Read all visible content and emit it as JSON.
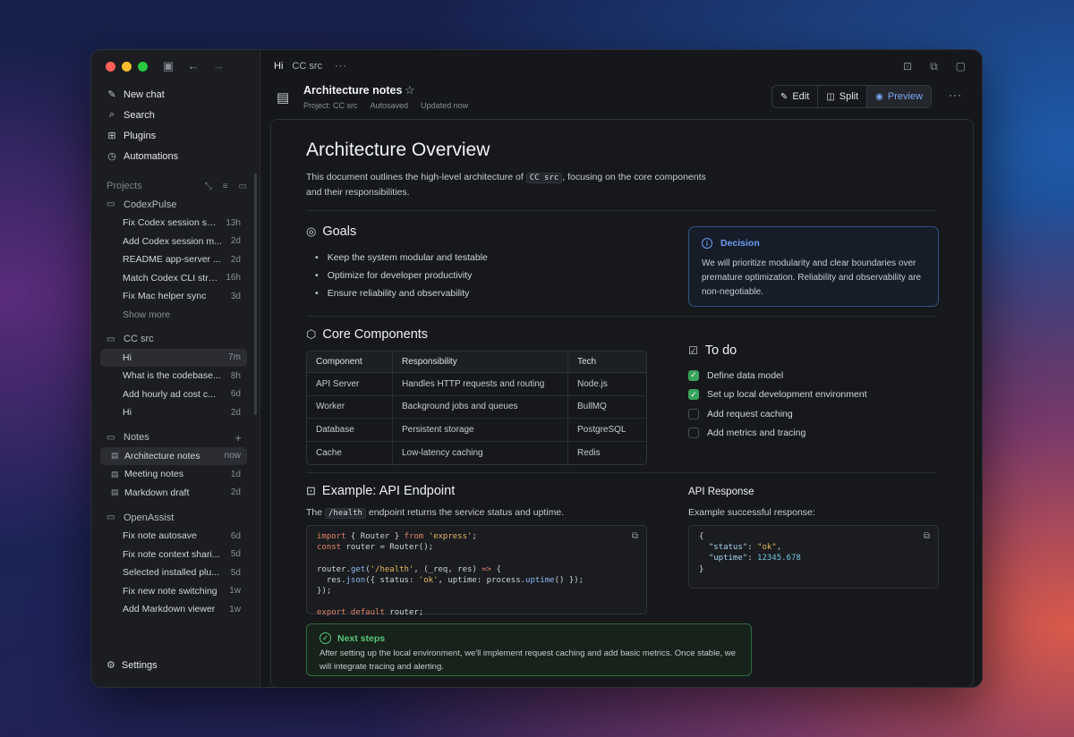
{
  "sidebar": {
    "nav": [
      {
        "label": "New chat",
        "icon": "edit-icon"
      },
      {
        "label": "Search",
        "icon": "search-icon"
      },
      {
        "label": "Plugins",
        "icon": "grid-icon"
      },
      {
        "label": "Automations",
        "icon": "clock-icon"
      }
    ],
    "projects_label": "Projects",
    "groups": [
      {
        "name": "CodexPulse",
        "threads": [
          {
            "title": "Fix Codex session sync",
            "meta": "13h"
          },
          {
            "title": "Add Codex session m...",
            "meta": "2d"
          },
          {
            "title": "README app-server ...",
            "meta": "2d"
          },
          {
            "title": "Match Codex CLI stre...",
            "meta": "16h"
          },
          {
            "title": "Fix Mac helper sync",
            "meta": "3d"
          }
        ],
        "show_more": "Show more"
      },
      {
        "name": "CC src",
        "threads": [
          {
            "title": "Hi",
            "meta": "7m"
          },
          {
            "title": "What is the codebase...",
            "meta": "8h"
          },
          {
            "title": "Add hourly ad cost c...",
            "meta": "6d"
          },
          {
            "title": "Hi",
            "meta": "2d"
          }
        ]
      },
      {
        "name": "Notes",
        "threads": [
          {
            "title": "Architecture notes",
            "meta": "now"
          },
          {
            "title": "Meeting notes",
            "meta": "1d"
          },
          {
            "title": "Markdown draft",
            "meta": "2d"
          }
        ]
      },
      {
        "name": "OpenAssist",
        "threads": [
          {
            "title": "Fix note autosave",
            "meta": "6d"
          },
          {
            "title": "Fix note context shari...",
            "meta": "5d"
          },
          {
            "title": "Selected installed plu...",
            "meta": "5d"
          },
          {
            "title": "Fix new note switching",
            "meta": "1w"
          },
          {
            "title": "Add Markdown viewer",
            "meta": "1w"
          }
        ]
      }
    ],
    "settings_label": "Settings"
  },
  "topbar": {
    "chat": "Hi",
    "project": "CC src",
    "more": "···"
  },
  "doc": {
    "title": "Architecture notes",
    "meta_project": "Project: CC src",
    "meta_saved": "Autosaved",
    "meta_updated": "Updated now",
    "modes": {
      "edit": "Edit",
      "split": "Split",
      "preview": "Preview"
    }
  },
  "content": {
    "h1": "Architecture Overview",
    "intro_before": "This document outlines the high-level architecture of ",
    "intro_code": "CC src",
    "intro_after": ", focusing on the core components and their responsibilities.",
    "goals_title": "Goals",
    "goals": [
      "Keep the system modular and testable",
      "Optimize for developer productivity",
      "Ensure reliability and observability"
    ],
    "decision": {
      "title": "Decision",
      "text": "We will prioritize modularity and clear boundaries over premature optimization. Reliability and observability are non-negotiable."
    },
    "components_title": "Core Components",
    "table": {
      "headers": [
        "Component",
        "Responsibility",
        "Tech"
      ],
      "rows": [
        [
          "API Server",
          "Handles HTTP requests and routing",
          "Node.js"
        ],
        [
          "Worker",
          "Background jobs and queues",
          "BullMQ"
        ],
        [
          "Database",
          "Persistent storage",
          "PostgreSQL"
        ],
        [
          "Cache",
          "Low-latency caching",
          "Redis"
        ]
      ]
    },
    "todo_title": "To do",
    "todos": [
      {
        "label": "Define data model",
        "checked": true
      },
      {
        "label": "Set up local development environment",
        "checked": true
      },
      {
        "label": "Add request caching",
        "checked": false
      },
      {
        "label": "Add metrics and tracing",
        "checked": false
      }
    ],
    "example_title": "Example: API Endpoint",
    "example_before": "The ",
    "example_code": "/health",
    "example_after": " endpoint returns the service status and uptime.",
    "api_title": "API Response",
    "api_sub": "Example successful response:",
    "next": {
      "title": "Next steps",
      "text": "After setting up the local environment, we'll implement request caching and add basic metrics. Once stable, we will integrate tracing and alerting."
    }
  }
}
